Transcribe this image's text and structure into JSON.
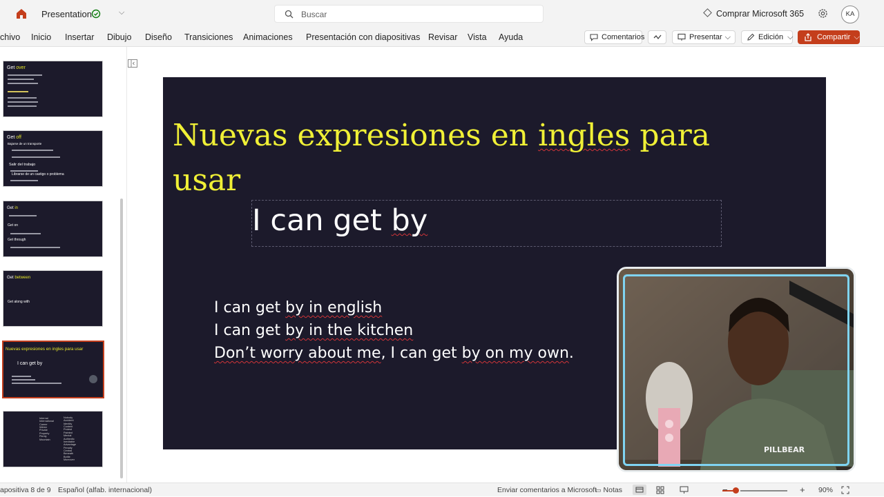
{
  "app": {
    "doc_title": "Presentation",
    "search_placeholder": "Buscar",
    "buy_label": "Comprar Microsoft 365",
    "avatar_initials": "KA",
    "accent_color": "#c43e1c"
  },
  "ribbon": {
    "tabs": [
      "chivo",
      "Inicio",
      "Insertar",
      "Dibujo",
      "Diseño",
      "Transiciones",
      "Animaciones",
      "Presentación con diapositivas",
      "Revisar",
      "Vista",
      "Ayuda"
    ],
    "comments_label": "Comentarios",
    "present_label": "Presentar",
    "editing_label": "Edición",
    "share_label": "Compartir"
  },
  "thumbnails": [
    {
      "title_a": "Get ",
      "title_b": "over",
      "selected": false
    },
    {
      "title_a": "Get ",
      "title_b": "off",
      "line1": "Bajarse de un transporte",
      "line2": "Salir del trabajo",
      "line3": "Librarse de un castigo o problema",
      "selected": false
    },
    {
      "title_a": "Get ",
      "title_b": "in",
      "line1": "Get on",
      "line2": "Get through",
      "selected": false
    },
    {
      "title_a": "Get ",
      "title_b": "between",
      "line1": "Get along with",
      "selected": false
    },
    {
      "title": "Nuevas expresiones en ingles para usar",
      "line1": "I can get by",
      "selected": true
    },
    {
      "col1": "Internal\nInternational\nCareer\nWinter\nPrivate\nProperty\nPlenty\nMountain",
      "col2": "Nobody\nAccident\nIdentity\nContent\nProtest\nPainted\nMental\nAuthentic\nInevitable\nAdvantage\nPenalty\nCentral\nBeneath\nBottle\nMoreover",
      "selected": false
    }
  ],
  "slide": {
    "title": "Nuevas expresiones en ingles para usar",
    "subtitle": "I can get by",
    "lines": [
      "I can get by in english",
      "I can get by in the kitchen",
      "Don’t worry about me, I can get by on my own."
    ],
    "background": "#1c1a2b",
    "title_color": "#f0f036"
  },
  "status": {
    "slide_counter": "apositiva 8 de 9",
    "language": "Español (alfab. internacional)",
    "feedback": "Enviar comentarios a Microsoft",
    "notes": "Notas",
    "zoom": "90%"
  }
}
